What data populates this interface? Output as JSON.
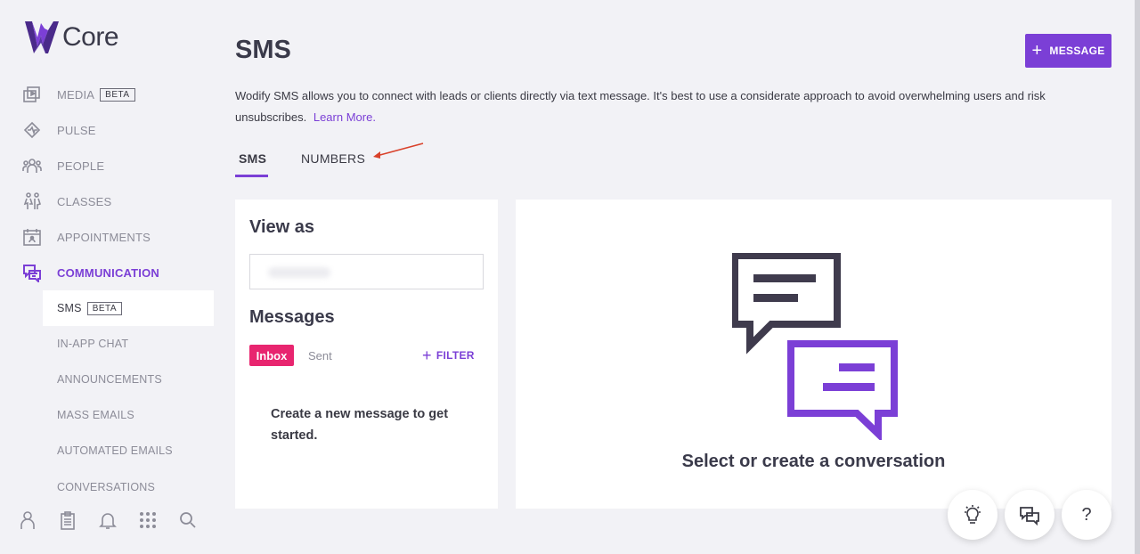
{
  "brand": {
    "name": "Core",
    "accent": "#7b3fd6"
  },
  "sidebar": {
    "items": [
      {
        "label": "MEDIA",
        "badge": "BETA",
        "icon": "media-icon"
      },
      {
        "label": "PULSE",
        "icon": "pulse-icon"
      },
      {
        "label": "PEOPLE",
        "icon": "people-icon"
      },
      {
        "label": "CLASSES",
        "icon": "classes-icon"
      },
      {
        "label": "APPOINTMENTS",
        "icon": "calendar-icon"
      },
      {
        "label": "COMMUNICATION",
        "icon": "communication-icon",
        "active": true
      }
    ],
    "sub_items": [
      {
        "label": "SMS",
        "badge": "BETA",
        "active": true
      },
      {
        "label": "IN-APP CHAT"
      },
      {
        "label": "ANNOUNCEMENTS"
      },
      {
        "label": "MASS EMAILS"
      },
      {
        "label": "AUTOMATED EMAILS"
      },
      {
        "label": "CONVERSATIONS"
      }
    ],
    "bottom_icons": [
      "profile-icon",
      "clipboard-icon",
      "bell-icon",
      "apps-grid-icon",
      "search-icon"
    ]
  },
  "header": {
    "title": "SMS",
    "new_message_label": "MESSAGE",
    "description": "Wodify SMS allows you to connect with leads or clients directly via text message. It's best to use a considerate approach to avoid overwhelming users and risk unsubscribes.",
    "learn_more": "Learn More."
  },
  "tabs": [
    {
      "label": "SMS",
      "active": true
    },
    {
      "label": "NUMBERS",
      "active": false
    }
  ],
  "left_panel": {
    "view_as_heading": "View as",
    "messages_heading": "Messages",
    "filters": {
      "inbox": "Inbox",
      "sent": "Sent",
      "filter": "FILTER"
    },
    "empty_text": "Create a new message to get started."
  },
  "right_panel": {
    "empty_text": "Select or create a conversation"
  },
  "fabs": [
    "lightbulb-icon",
    "chat-icon",
    "help-icon"
  ],
  "colors": {
    "inbox_badge": "#e8256f",
    "dark_bubble": "#3f3b4d",
    "purple_bubble": "#7b3fd6"
  }
}
